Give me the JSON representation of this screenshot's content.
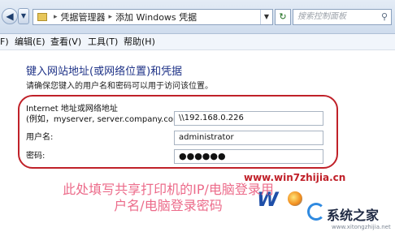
{
  "addressbar": {
    "crumbs": [
      "凭据管理器",
      "添加 Windows 凭据"
    ],
    "search_placeholder": "搜索控制面板",
    "back_glyph": "◀",
    "forward_glyph": "▼",
    "refresh_glyph": "↻",
    "search_glyph": "⚲"
  },
  "menubar": {
    "items": [
      "F)",
      "编辑(E)",
      "查看(V)",
      "工具(T)",
      "帮助(H)"
    ]
  },
  "page": {
    "heading": "键入网站地址(或网络位置)和凭据",
    "description": "请确保您键入的用户名和密码可以用于访问该位置。"
  },
  "form": {
    "address_label_line1": "Internet 地址或网络地址",
    "address_label_line2": "(例如，myserver, server.company.com):",
    "address_value": "\\\\192.168.0.226",
    "username_label": "用户名:",
    "username_value": "administrator",
    "password_label": "密码:",
    "password_value": "●●●●●●"
  },
  "annotation": {
    "caption": "此处填写共享打印机的IP/电脑登录用户名/电脑登录密码"
  },
  "watermark": {
    "url": "www.win7zhijia.cn",
    "logo_text": "W",
    "site_name": "系统之家",
    "small_text": "www.xitongzhijia.net"
  },
  "colors": {
    "highlight_border": "#c02129",
    "caption": "#ec6b8a",
    "heading": "#1e3287"
  }
}
